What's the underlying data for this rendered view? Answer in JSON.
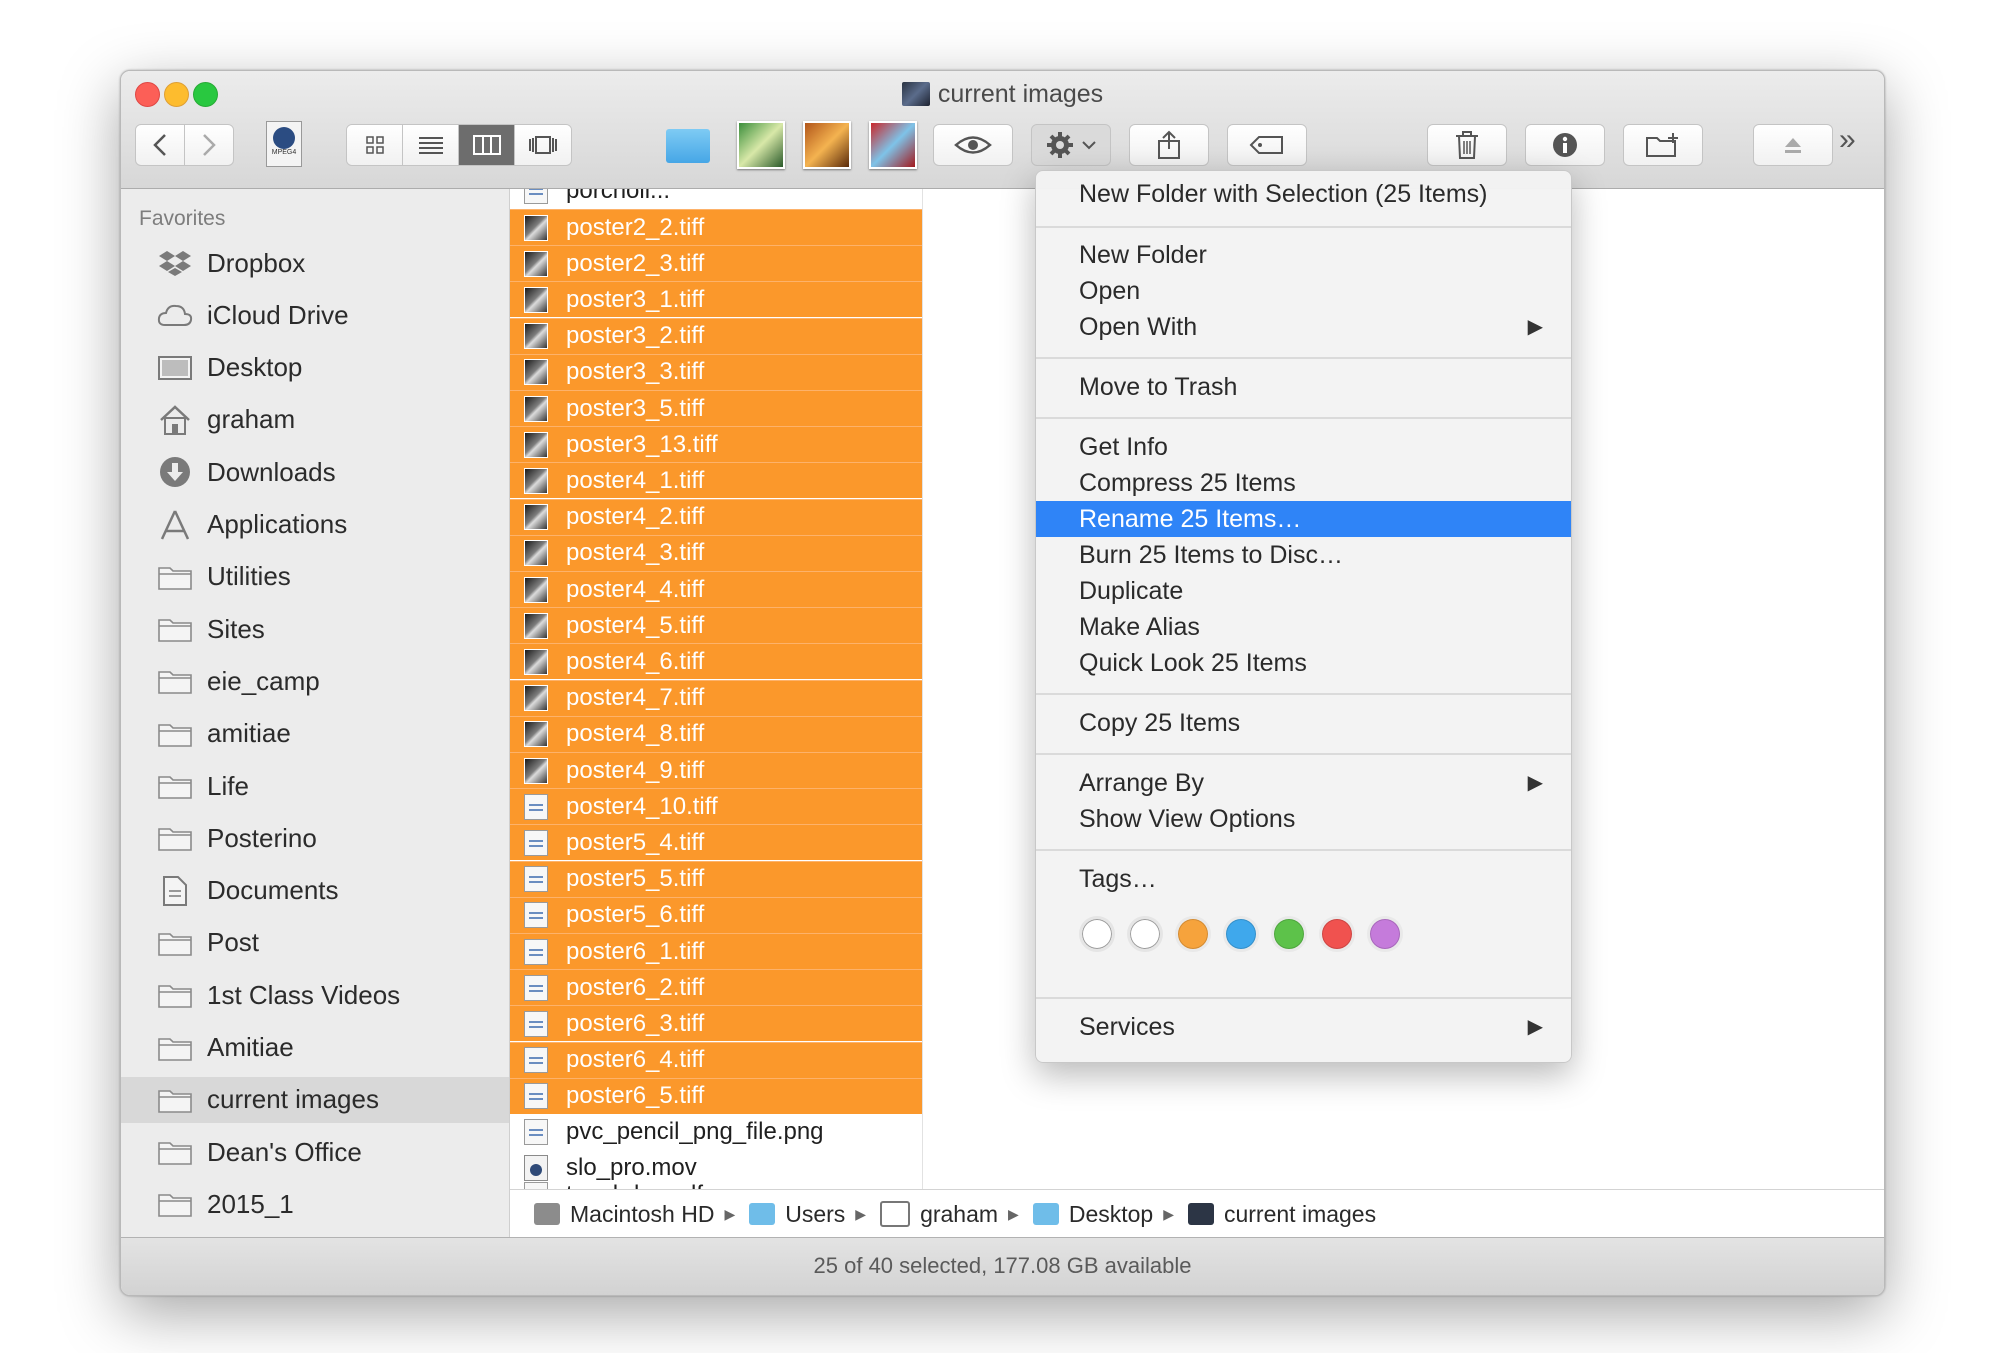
{
  "window": {
    "title": "current images"
  },
  "colors": {
    "selection": "#fb982b",
    "menu_highlight": "#2f84f7"
  },
  "toolbar": {
    "back_icon": "chevron-left-icon",
    "forward_icon": "chevron-right-icon",
    "file_icon_label": "MPEG4",
    "view_modes": [
      "icon-view-icon",
      "list-view-icon",
      "column-view-icon",
      "cover-flow-icon"
    ],
    "quick_look_icon": "eye-icon",
    "action_icon": "gear-icon",
    "share_icon": "share-icon",
    "tags_icon": "tag-icon",
    "trash_icon": "trash-icon",
    "info_icon": "info-icon",
    "new_folder_icon": "new-folder-icon",
    "eject_icon": "eject-icon",
    "overflow_label": "»"
  },
  "sidebar": {
    "heading": "Favorites",
    "items": [
      {
        "label": "Dropbox",
        "icon": "dropbox-icon"
      },
      {
        "label": "iCloud Drive",
        "icon": "cloud-icon"
      },
      {
        "label": "Desktop",
        "icon": "desktop-icon"
      },
      {
        "label": "graham",
        "icon": "home-icon"
      },
      {
        "label": "Downloads",
        "icon": "download-icon"
      },
      {
        "label": "Applications",
        "icon": "applications-icon"
      },
      {
        "label": "Utilities",
        "icon": "folder-icon"
      },
      {
        "label": "Sites",
        "icon": "folder-icon"
      },
      {
        "label": "eie_camp",
        "icon": "folder-icon"
      },
      {
        "label": "amitiae",
        "icon": "folder-icon"
      },
      {
        "label": "Life",
        "icon": "folder-icon"
      },
      {
        "label": "Posterino",
        "icon": "folder-icon"
      },
      {
        "label": "Documents",
        "icon": "documents-icon"
      },
      {
        "label": "Post",
        "icon": "folder-icon"
      },
      {
        "label": "1st Class Videos",
        "icon": "folder-icon"
      },
      {
        "label": "Amitiae",
        "icon": "folder-icon"
      },
      {
        "label": "current images",
        "icon": "folder-icon"
      },
      {
        "label": "Dean's Office",
        "icon": "folder-icon"
      },
      {
        "label": "2015_1",
        "icon": "folder-icon"
      }
    ]
  },
  "files": {
    "top_partial": "porcholl...",
    "bottom_partial": "top_hdov.pdf",
    "rows": [
      {
        "name": "poster2_2.tiff",
        "selected": true,
        "kind": "photo"
      },
      {
        "name": "poster2_3.tiff",
        "selected": true,
        "kind": "photo"
      },
      {
        "name": "poster3_1.tiff",
        "selected": true,
        "kind": "photo"
      },
      {
        "name": "poster3_2.tiff",
        "selected": true,
        "kind": "photo"
      },
      {
        "name": "poster3_3.tiff",
        "selected": true,
        "kind": "photo"
      },
      {
        "name": "poster3_5.tiff",
        "selected": true,
        "kind": "photo"
      },
      {
        "name": "poster3_13.tiff",
        "selected": true,
        "kind": "photo"
      },
      {
        "name": "poster4_1.tiff",
        "selected": true,
        "kind": "photo"
      },
      {
        "name": "poster4_2.tiff",
        "selected": true,
        "kind": "photo"
      },
      {
        "name": "poster4_3.tiff",
        "selected": true,
        "kind": "photo"
      },
      {
        "name": "poster4_4.tiff",
        "selected": true,
        "kind": "photo"
      },
      {
        "name": "poster4_5.tiff",
        "selected": true,
        "kind": "photo"
      },
      {
        "name": "poster4_6.tiff",
        "selected": true,
        "kind": "photo"
      },
      {
        "name": "poster4_7.tiff",
        "selected": true,
        "kind": "photo"
      },
      {
        "name": "poster4_8.tiff",
        "selected": true,
        "kind": "photo"
      },
      {
        "name": "poster4_9.tiff",
        "selected": true,
        "kind": "photo"
      },
      {
        "name": "poster4_10.tiff",
        "selected": true,
        "kind": "doc"
      },
      {
        "name": "poster5_4.tiff",
        "selected": true,
        "kind": "doc"
      },
      {
        "name": "poster5_5.tiff",
        "selected": true,
        "kind": "doc"
      },
      {
        "name": "poster5_6.tiff",
        "selected": true,
        "kind": "doc"
      },
      {
        "name": "poster6_1.tiff",
        "selected": true,
        "kind": "doc"
      },
      {
        "name": "poster6_2.tiff",
        "selected": true,
        "kind": "doc"
      },
      {
        "name": "poster6_3.tiff",
        "selected": true,
        "kind": "doc"
      },
      {
        "name": "poster6_4.tiff",
        "selected": true,
        "kind": "doc"
      },
      {
        "name": "poster6_5.tiff",
        "selected": true,
        "kind": "doc"
      },
      {
        "name": "pvc_pencil_png_file.png",
        "selected": false,
        "kind": "doc"
      },
      {
        "name": "slo_pro.mov",
        "selected": false,
        "kind": "mov"
      }
    ]
  },
  "pathbar": [
    {
      "label": "Macintosh HD",
      "icon": "hard-drive-icon"
    },
    {
      "label": "Users",
      "icon": "folder-icon"
    },
    {
      "label": "graham",
      "icon": "home-icon"
    },
    {
      "label": "Desktop",
      "icon": "folder-icon"
    },
    {
      "label": "current images",
      "icon": "image-folder-icon"
    }
  ],
  "status": {
    "text": "25 of 40 selected, 177.08 GB available"
  },
  "menu": {
    "items": {
      "new_folder_with_selection": "New Folder with Selection (25 Items)",
      "new_folder": "New Folder",
      "open": "Open",
      "open_with": "Open With",
      "move_to_trash": "Move to Trash",
      "get_info": "Get Info",
      "compress": "Compress 25 Items",
      "rename": "Rename 25 Items…",
      "burn": "Burn 25 Items to Disc…",
      "duplicate": "Duplicate",
      "make_alias": "Make Alias",
      "quick_look": "Quick Look 25 Items",
      "copy": "Copy 25 Items",
      "arrange_by": "Arrange By",
      "show_view_options": "Show View Options",
      "tags": "Tags…",
      "services": "Services"
    },
    "submenu_arrow": "▶",
    "highlighted": "rename",
    "tag_colors": [
      {
        "name": "none",
        "color": "#ffffff"
      },
      {
        "name": "none-2",
        "color": "#ffffff"
      },
      {
        "name": "orange",
        "color": "#f6a33c"
      },
      {
        "name": "blue",
        "color": "#3fa8ec"
      },
      {
        "name": "green",
        "color": "#5dc24a"
      },
      {
        "name": "red",
        "color": "#f0524f"
      },
      {
        "name": "purple",
        "color": "#c57bdb"
      }
    ]
  }
}
